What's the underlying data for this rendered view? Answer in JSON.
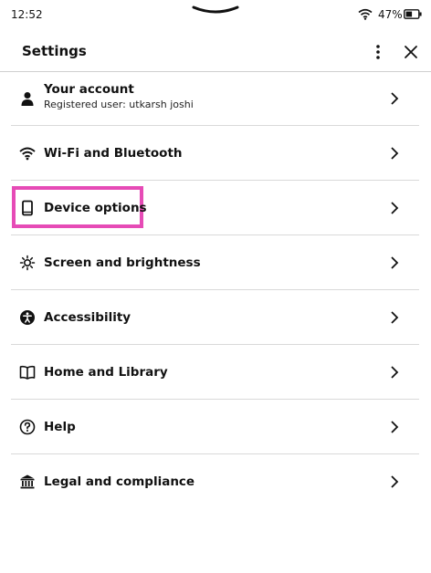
{
  "status": {
    "time": "12:52",
    "battery": "47%",
    "icons": [
      "wifi-icon",
      "battery-icon"
    ]
  },
  "header": {
    "title": "Settings",
    "more_icon": "more-vertical-icon",
    "close_icon": "close-icon"
  },
  "items": [
    {
      "label": "Your account",
      "sublabel": "Registered user: utkarsh joshi",
      "icon": "person-icon"
    },
    {
      "label": "Wi-Fi and Bluetooth",
      "icon": "wifi-icon"
    },
    {
      "label": "Device options",
      "icon": "device-icon",
      "highlighted": true
    },
    {
      "label": "Screen and brightness",
      "icon": "brightness-icon"
    },
    {
      "label": "Accessibility",
      "icon": "accessibility-icon"
    },
    {
      "label": "Home and Library",
      "icon": "book-icon"
    },
    {
      "label": "Help",
      "icon": "help-icon"
    },
    {
      "label": "Legal and compliance",
      "icon": "bank-icon"
    }
  ],
  "colors": {
    "highlight": "#e64bb6",
    "divider": "#d9d9d9"
  }
}
